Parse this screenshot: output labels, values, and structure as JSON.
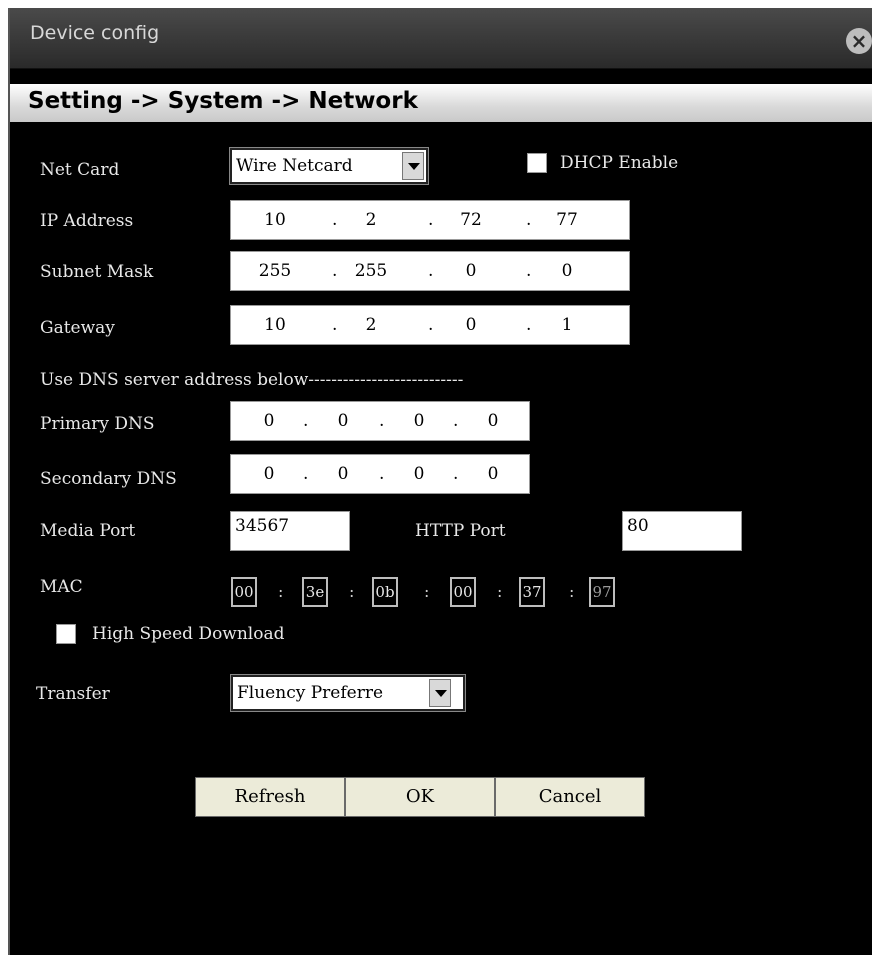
{
  "window": {
    "title": "Device config",
    "close_icon": "close-icon"
  },
  "breadcrumb": "Setting -> System -> Network",
  "net_card": {
    "label": "Net Card",
    "value": "Wire Netcard"
  },
  "dhcp": {
    "label": "DHCP Enable",
    "checked": false
  },
  "ip_address": {
    "label": "IP Address",
    "octets": [
      "10",
      "2",
      "72",
      "77"
    ]
  },
  "subnet_mask": {
    "label": "Subnet Mask",
    "octets": [
      "255",
      "255",
      "0",
      "0"
    ]
  },
  "gateway": {
    "label": "Gateway",
    "octets": [
      "10",
      "2",
      "0",
      "1"
    ]
  },
  "dns_note": "Use DNS server address below---------------------------",
  "primary_dns": {
    "label": "Primary DNS",
    "octets": [
      "0",
      "0",
      "0",
      "0"
    ]
  },
  "secondary_dns": {
    "label": "Secondary DNS",
    "octets": [
      "0",
      "0",
      "0",
      "0"
    ]
  },
  "media_port": {
    "label": "Media Port",
    "value": "34567"
  },
  "http_port": {
    "label": "HTTP Port",
    "value": "80"
  },
  "mac": {
    "label": "MAC",
    "parts": [
      "00",
      "3e",
      "0b",
      "00",
      "37",
      "97"
    ]
  },
  "high_speed": {
    "label": "High Speed Download",
    "checked": false
  },
  "transfer": {
    "label": "Transfer",
    "value": "Fluency Preferre"
  },
  "buttons": {
    "refresh": "Refresh",
    "ok": "OK",
    "cancel": "Cancel"
  }
}
